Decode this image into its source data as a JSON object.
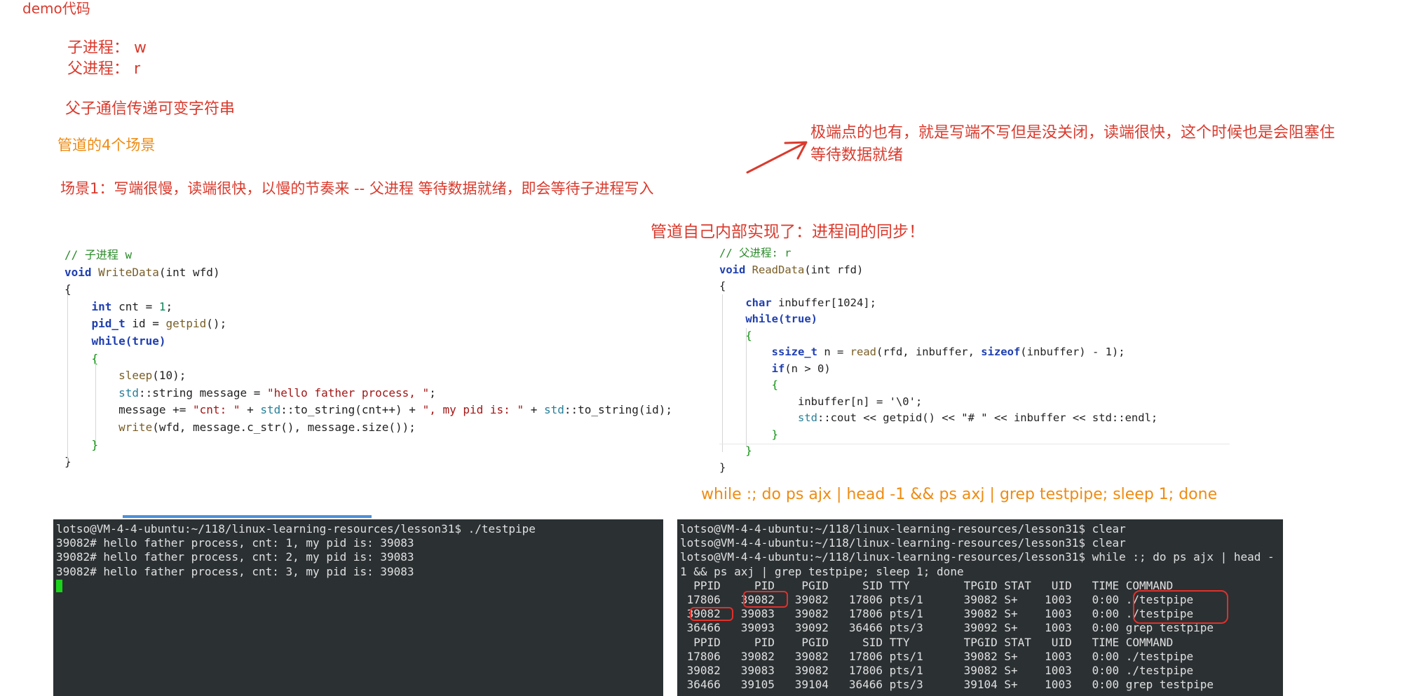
{
  "notes": {
    "demo_title": "demo代码",
    "child_process": "子进程： w",
    "parent_process": "父进程： r",
    "parent_child_comm": "父子通信传递可变字符串",
    "pipe_scenarios": "管道的4个场景",
    "scenario1": "场景1：写端很慢，读端很快，以慢的节奏来 -- 父进程 等待数据就绪，即会等待子进程写入",
    "extreme_line1": "极端点的也有，就是写端不写但是没关闭，读端很快，这个时候也是会阻塞住",
    "extreme_line2": "等待数据就绪",
    "sync_note": "管道自己内部实现了：进程间的同步！",
    "while_cmd": "while :; do ps ajx | head -1 && ps axj | grep testpipe; sleep 1; done"
  },
  "code_left": {
    "comment": "// 子进程 w",
    "sig_kw": "void",
    "sig_fn": "WriteData",
    "sig_params": "(int wfd)",
    "brace_open": "{",
    "l_int": "int",
    "l_cnt": " cnt = ",
    "l_one": "1",
    "l_semi": ";",
    "l_pidt": "pid_t",
    "l_id": " id = ",
    "l_getpid": "getpid",
    "l_getpid_tail": "();",
    "l_while": "while",
    "l_true": "(true)",
    "inner_open": "{",
    "l_sleep": "sleep",
    "l_sleep_arg": "(10);",
    "l_std1": "std",
    "l_string_msg": "::string message = ",
    "l_hello": "\"hello father process, \"",
    "l_semi2": ";",
    "l_msg": "message += ",
    "l_cnt_str": "\"cnt: \"",
    "l_plus1": " + ",
    "l_std2": "std",
    "l_tostr1": "::to_string(cnt++) + ",
    "l_pid_str": "\", my pid is: \"",
    "l_plus2": " + ",
    "l_std3": "std",
    "l_tostr2": "::to_string(id);",
    "l_write": "write",
    "l_write_args": "(wfd, message.c_str(), message.size());",
    "inner_close": "}",
    "brace_close": "}"
  },
  "code_right": {
    "comment": "// 父进程: r",
    "sig_kw": "void",
    "sig_fn": "ReadData",
    "sig_params": "(int rfd)",
    "brace_open": "{",
    "l_char": "char",
    "l_buf": " inbuffer[1024];",
    "l_while": "while",
    "l_true": "(true)",
    "w_open": "{",
    "l_ssize": "ssize_t",
    "l_n": " n = ",
    "l_read": "read",
    "l_read_args": "(rfd, inbuffer, ",
    "l_sizeof": "sizeof",
    "l_sizeof_tail": "(inbuffer) - 1);",
    "l_if": "if",
    "l_if_cond": "(n > 0)",
    "if_open": "{",
    "l_assign": "inbuffer[n] = '\\0';",
    "l_std": "std",
    "l_cout": "::cout << getpid() << \"# \" << inbuffer << std::endl;",
    "if_close": "}",
    "w_close": "}",
    "brace_close": "}"
  },
  "term_left": {
    "lines": [
      "lotso@VM-4-4-ubuntu:~/118/linux-learning-resources/lesson31$ ./testpipe",
      "39082# hello father process, cnt: 1, my pid is: 39083",
      "39082# hello father process, cnt: 2, my pid is: 39083",
      "39082# hello father process, cnt: 3, my pid is: 39083"
    ]
  },
  "term_right": {
    "lines": [
      "lotso@VM-4-4-ubuntu:~/118/linux-learning-resources/lesson31$ clear",
      "lotso@VM-4-4-ubuntu:~/118/linux-learning-resources/lesson31$ clear",
      "lotso@VM-4-4-ubuntu:~/118/linux-learning-resources/lesson31$ while :; do ps ajx | head -",
      "1 && ps axj | grep testpipe; sleep 1; done",
      "  PPID     PID    PGID     SID TTY        TPGID STAT   UID   TIME COMMAND",
      " 17806   39082   39082   17806 pts/1      39082 S+    1003   0:00 ./testpipe",
      " 39082   39083   39082   17806 pts/1      39082 S+    1003   0:00 ./testpipe",
      " 36466   39093   39092   36466 pts/3      39092 S+    1003   0:00 grep testpipe",
      "  PPID     PID    PGID     SID TTY        TPGID STAT   UID   TIME COMMAND",
      " 17806   39082   39082   17806 pts/1      39082 S+    1003   0:00 ./testpipe",
      " 39082   39083   39082   17806 pts/1      39082 S+    1003   0:00 ./testpipe",
      " 36466   39105   39104   36466 pts/3      39104 S+    1003   0:00 grep testpipe"
    ]
  }
}
